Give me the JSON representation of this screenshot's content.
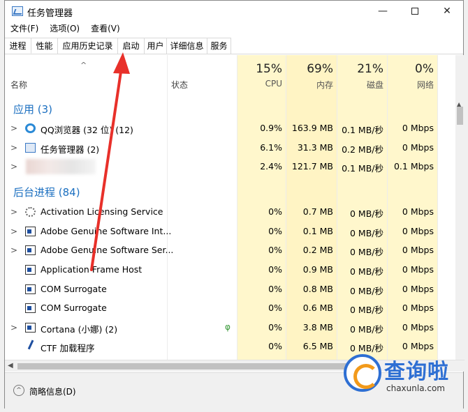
{
  "window": {
    "title": "任务管理器",
    "minimize": "—",
    "close": "✕"
  },
  "menu": [
    "文件(F)",
    "选项(O)",
    "查看(V)"
  ],
  "tabs": [
    "进程",
    "性能",
    "应用历史记录",
    "启动",
    "用户",
    "详细信息",
    "服务"
  ],
  "active_tab": "进程",
  "columns": {
    "name": "名称",
    "sort_caret": "^",
    "status": "状态",
    "cpu": {
      "pct": "15%",
      "label": "CPU"
    },
    "memory": {
      "pct": "69%",
      "label": "内存"
    },
    "disk": {
      "pct": "21%",
      "label": "磁盘"
    },
    "network": {
      "pct": "0%",
      "label": "网络"
    }
  },
  "groups": {
    "apps": "应用 (3)",
    "background": "后台进程 (84)"
  },
  "apps": [
    {
      "icon": "qq-browser-icon",
      "name": "QQ浏览器 (32 位) (12)",
      "cpu": "0.9%",
      "memory": "163.9 MB",
      "disk": "0.1 MB/秒",
      "network": "0 Mbps",
      "expander": ">"
    },
    {
      "icon": "task-manager-icon",
      "name": "任务管理器 (2)",
      "cpu": "6.1%",
      "memory": "31.3 MB",
      "disk": "0.2 MB/秒",
      "network": "0 Mbps",
      "expander": ">"
    },
    {
      "icon": "blurred-icon",
      "name": "",
      "cpu": "2.4%",
      "memory": "121.7 MB",
      "disk": "0.1 MB/秒",
      "network": "0.1 Mbps",
      "expander": ">"
    }
  ],
  "background": [
    {
      "icon": "gear-icon",
      "name": "Activation Licensing Service",
      "cpu": "0%",
      "memory": "0.7 MB",
      "disk": "0 MB/秒",
      "network": "0 Mbps",
      "expander": ">"
    },
    {
      "icon": "window-icon",
      "name": "Adobe Genuine Software Int...",
      "cpu": "0%",
      "memory": "0.1 MB",
      "disk": "0 MB/秒",
      "network": "0 Mbps",
      "expander": ">"
    },
    {
      "icon": "window-icon",
      "name": "Adobe Genuine Software Ser...",
      "cpu": "0%",
      "memory": "0.2 MB",
      "disk": "0 MB/秒",
      "network": "0 Mbps",
      "expander": ">"
    },
    {
      "icon": "window-icon",
      "name": "Application Frame Host",
      "cpu": "0%",
      "memory": "0.9 MB",
      "disk": "0 MB/秒",
      "network": "0 Mbps",
      "expander": ""
    },
    {
      "icon": "window-icon",
      "name": "COM Surrogate",
      "cpu": "0%",
      "memory": "0.8 MB",
      "disk": "0 MB/秒",
      "network": "0 Mbps",
      "expander": ""
    },
    {
      "icon": "window-icon",
      "name": "COM Surrogate",
      "cpu": "0%",
      "memory": "0.6 MB",
      "disk": "0 MB/秒",
      "network": "0 Mbps",
      "expander": ""
    },
    {
      "icon": "window-icon",
      "name": "Cortana (小娜) (2)",
      "cpu": "0%",
      "memory": "3.8 MB",
      "disk": "0 MB/秒",
      "network": "0 Mbps",
      "expander": ">",
      "leaf": "φ"
    },
    {
      "icon": "pen-icon",
      "name": "CTF 加载程序",
      "cpu": "0%",
      "memory": "6.5 MB",
      "disk": "0 MB/秒",
      "network": "0 Mbps",
      "expander": ""
    }
  ],
  "scroll": {
    "up": "▲",
    "left": "◀"
  },
  "footer": {
    "fewer_details": "简略信息(D)",
    "fewer_icon": "^"
  },
  "watermark": {
    "text": "查询啦",
    "url": "chaxunla.com"
  },
  "colors": {
    "accent_blue": "#1b6fc0",
    "highlight": "#fff4c4",
    "arrow_red": "#e8302a"
  }
}
